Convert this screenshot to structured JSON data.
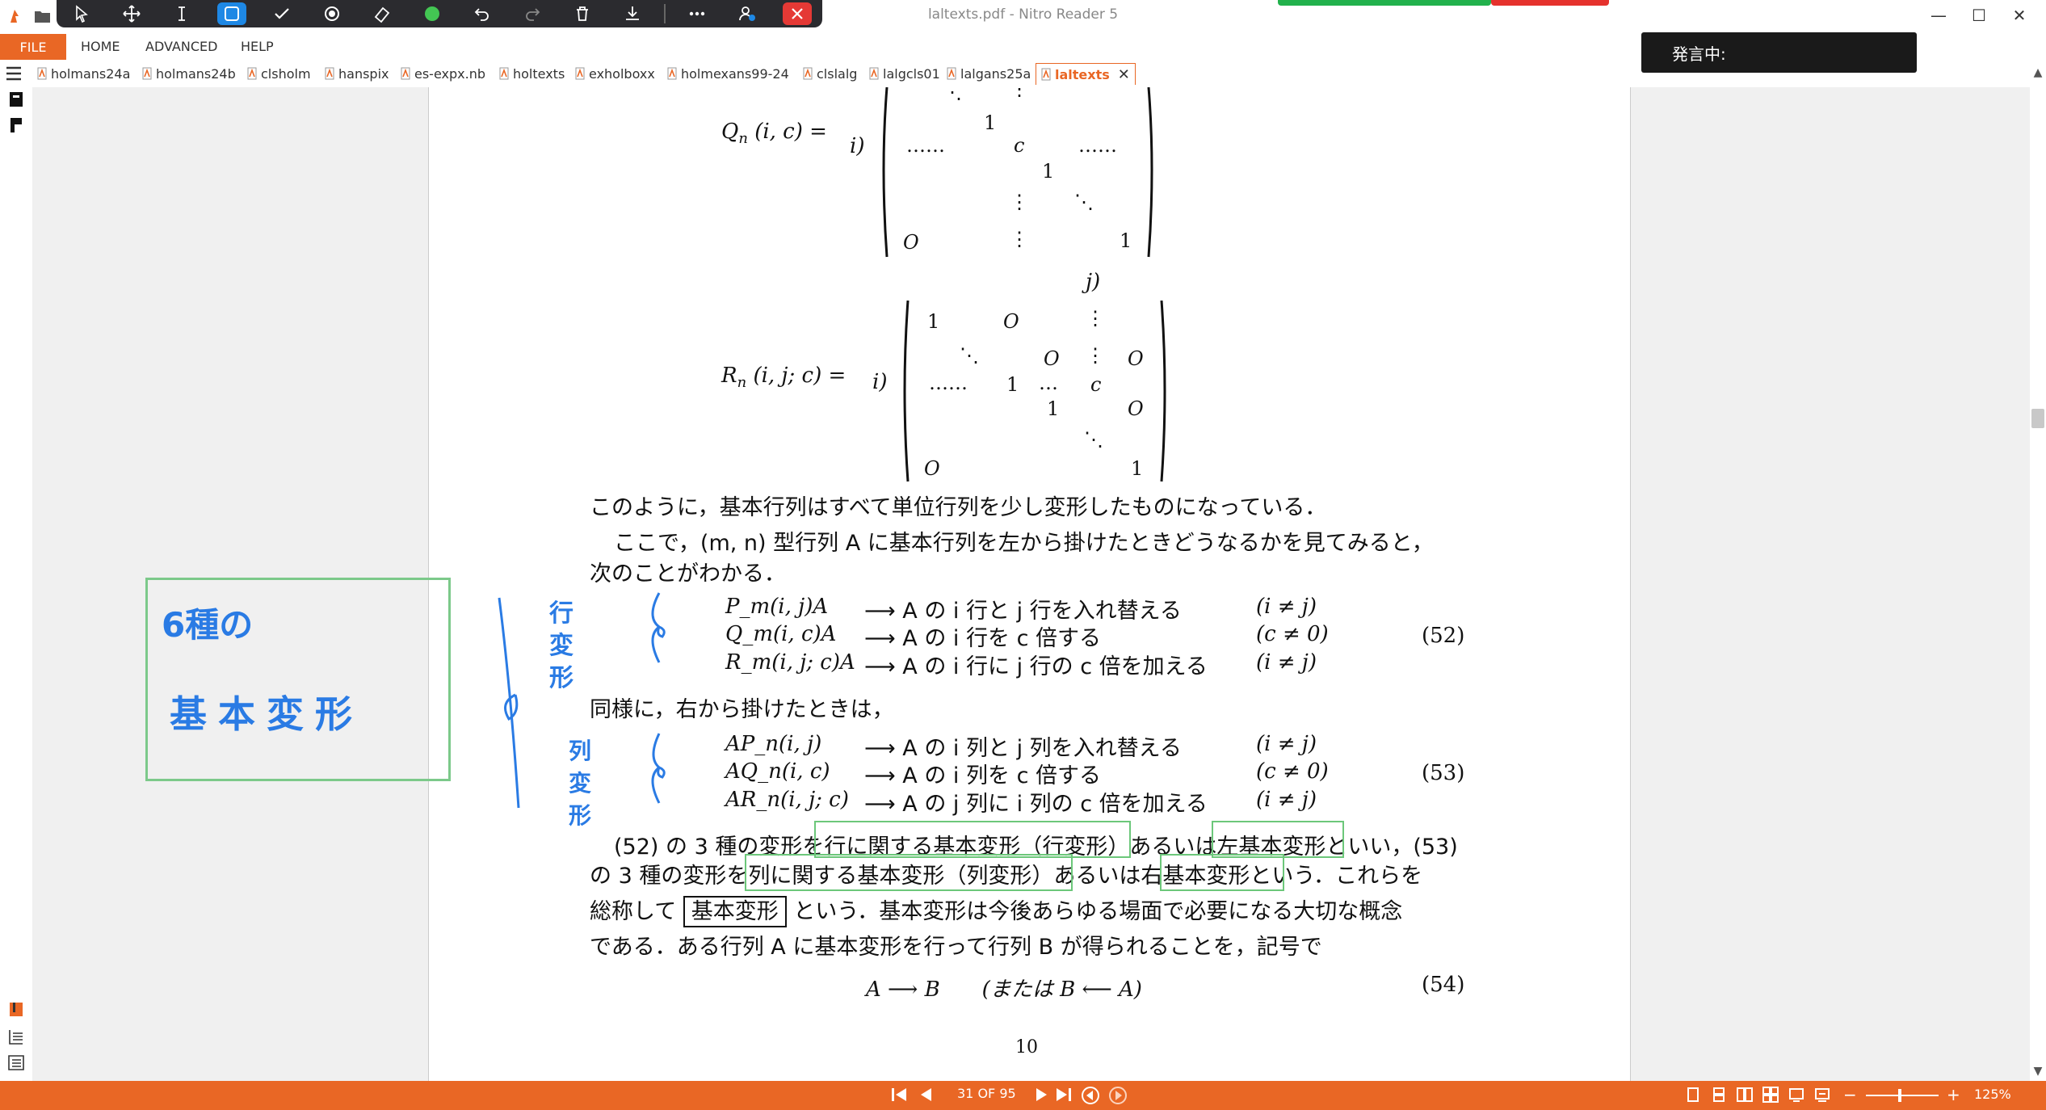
{
  "window": {
    "title": "laltexts.pdf - Nitro Reader 5",
    "minimize": "—",
    "maximize": "☐",
    "close": "✕"
  },
  "menu": {
    "file": "FILE",
    "home": "HOME",
    "advanced": "ADVANCED",
    "help": "HELP"
  },
  "tabs": [
    {
      "label": "holmans24a"
    },
    {
      "label": "holmans24b"
    },
    {
      "label": "clsholm"
    },
    {
      "label": "hanspix"
    },
    {
      "label": "es-expx.nb"
    },
    {
      "label": "holtexts"
    },
    {
      "label": "exholboxx"
    },
    {
      "label": "holmexans99-24"
    },
    {
      "label": "clslalg"
    },
    {
      "label": "lalgcls01"
    },
    {
      "label": "lalgans25a"
    },
    {
      "label": "laltexts",
      "active": true
    }
  ],
  "tab_close": "✕",
  "overlay": {
    "speaking": "発言中:"
  },
  "doc": {
    "q_lhs": "Q",
    "q_sub": "n",
    "q_args": "(i, c) =",
    "q_row_label": "i)",
    "q_col_label": "j)",
    "r_lhs": "R",
    "r_sub": "n",
    "r_args": "(i, j; c) =",
    "r_row_label": "i)",
    "para1": "このように，基本行列はすべて単位行列を少し変形したものになっている．",
    "para2_line1": "ここで，(m, n) 型行列 A に基本行列を左から掛けたときどうなるかを見てみると，",
    "para2_line2": "次のことがわかる．",
    "eq52_rows": [
      {
        "lhs": "P_m(i, j)A",
        "rhs": "⟶ A の i 行と j 行を入れ替える",
        "cond": "(i ≠ j)"
      },
      {
        "lhs": "Q_m(i, c)A",
        "rhs": "⟶ A の i 行を c 倍する",
        "cond": "(c ≠ 0)"
      },
      {
        "lhs": "R_m(i, j; c)A",
        "rhs": "⟶ A の i 行に j 行の c 倍を加える",
        "cond": "(i ≠ j)"
      }
    ],
    "eq52_no": "(52)",
    "para3": "同様に，右から掛けたときは，",
    "eq53_rows": [
      {
        "lhs": "AP_n(i, j)",
        "rhs": "⟶ A の i 列と j 列を入れ替える",
        "cond": "(i ≠ j)"
      },
      {
        "lhs": "AQ_n(i, c)",
        "rhs": "⟶ A の i 列を c 倍する",
        "cond": "(c ≠ 0)"
      },
      {
        "lhs": "AR_n(i, j; c)",
        "rhs": "⟶ A の j 列に i 列の c 倍を加える",
        "cond": "(i ≠ j)"
      }
    ],
    "eq53_no": "(53)",
    "para4_line1": "(52) の 3 種の変形を行に関する基本変形（行変形）あるいは左基本変形といい，(53)",
    "para4_line2": "の 3 種の変形を列に関する基本変形（列変形）あるいは右基本変形という．これらを",
    "para4_line3_pre": "総称して",
    "para4_line3_boxed": "基本変形",
    "para4_line3_post": "という．基本変形は今後あらゆる場面で必要になる大切な概念",
    "para4_line4": "である．ある行列 A に基本変形を行って行列 B が得られることを，記号で",
    "eq54": "A ⟶ B　　(または B ⟵ A)",
    "eq54_no": "(54)",
    "page_number": "10"
  },
  "handwriting": {
    "note_line1": "6種の",
    "note_line2": "基本変形",
    "row_label": "行変形",
    "col_label": "列変形"
  },
  "status": {
    "page_indicator": "31 OF 95",
    "zoom": "125%"
  }
}
